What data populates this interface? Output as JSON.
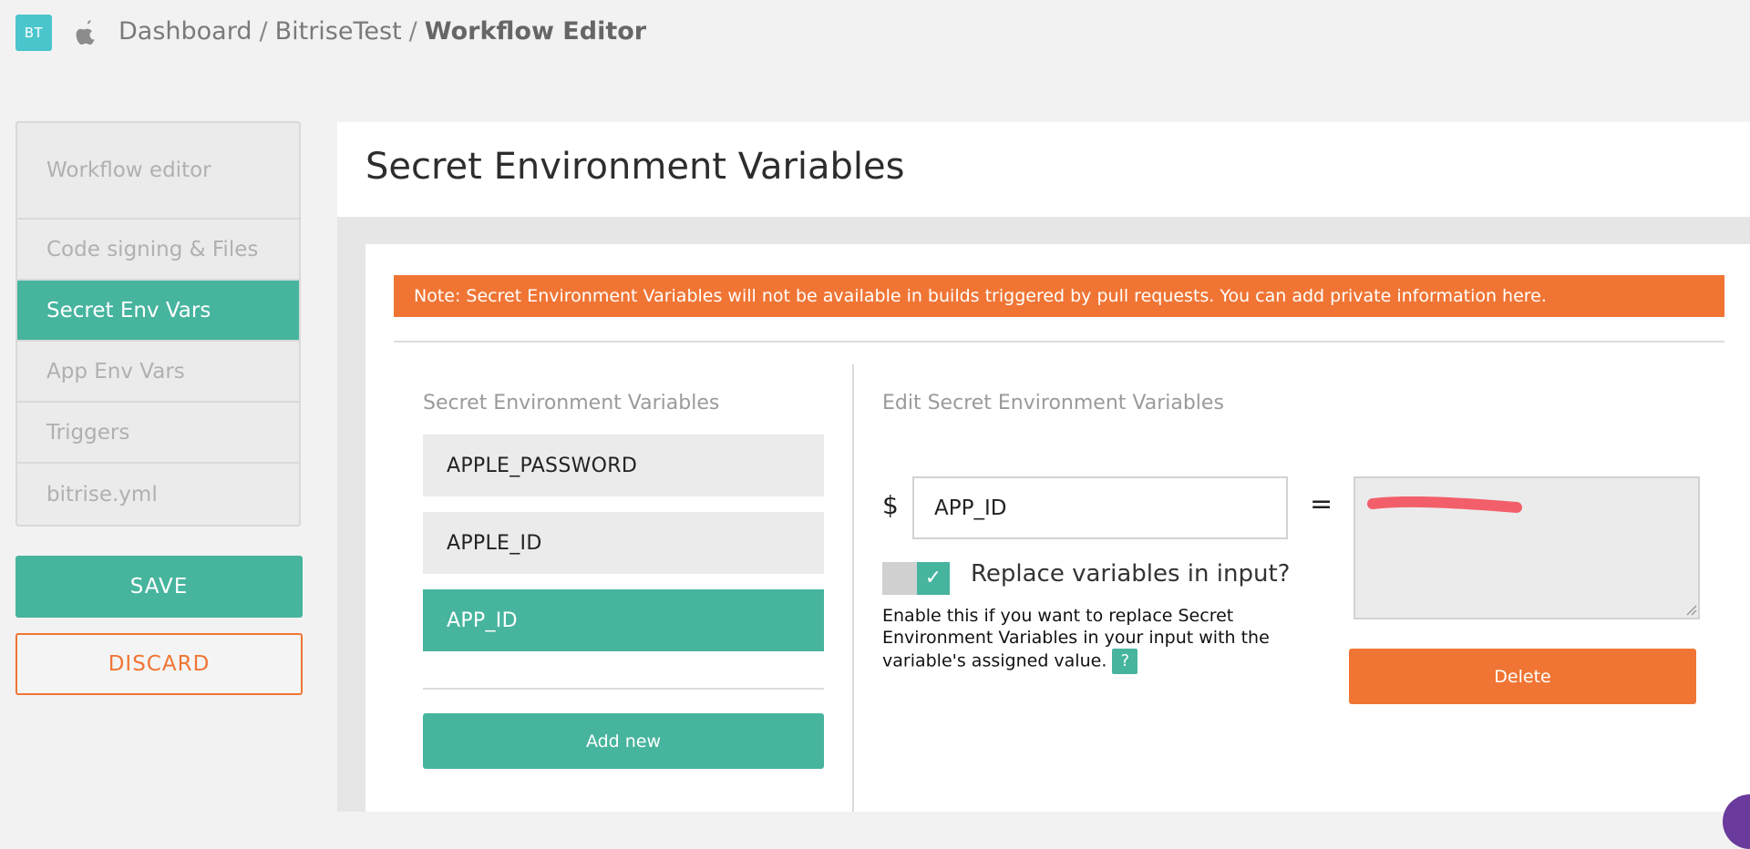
{
  "header": {
    "logo_text": "BT",
    "platform_icon": "apple-icon",
    "breadcrumb": {
      "dashboard": "Dashboard",
      "app": "BitriseTest",
      "current": "Workflow Editor",
      "separator": "/"
    }
  },
  "sidebar": {
    "items": [
      {
        "label": "Workflow editor"
      },
      {
        "label": "Code signing & Files"
      },
      {
        "label": "Secret Env Vars"
      },
      {
        "label": "App Env Vars"
      },
      {
        "label": "Triggers"
      },
      {
        "label": "bitrise.yml"
      }
    ],
    "active_item": "Secret Env Vars",
    "save_label": "SAVE",
    "discard_label": "DISCARD"
  },
  "main": {
    "title": "Secret Environment Variables",
    "note": "Note: Secret Environment Variables will not be available in builds triggered by pull requests. You can add private information here."
  },
  "variables": {
    "list_title": "Secret Environment Variables",
    "items": [
      {
        "name": "APPLE_PASSWORD"
      },
      {
        "name": "APPLE_ID"
      },
      {
        "name": "APP_ID"
      }
    ],
    "selected": "APP_ID",
    "add_label": "Add new"
  },
  "editor": {
    "title": "Edit Secret Environment Variables",
    "dollar": "$",
    "key_value": "APP_ID",
    "equals": "=",
    "value_redacted": true,
    "replace_toggle_checked": true,
    "replace_label": "Replace variables in input?",
    "help_text": "Enable this if you want to replace Secret Environment Variables in your input with the variable's assigned value.",
    "help_badge": "?",
    "delete_label": "Delete"
  },
  "colors": {
    "accent_green": "#47b49e",
    "accent_orange": "#f07534",
    "logo_cyan": "#4bc5cc",
    "background": "#f2f2f2",
    "redaction_marker": "#f25f6a",
    "chat_bubble": "#6a3a9c"
  }
}
